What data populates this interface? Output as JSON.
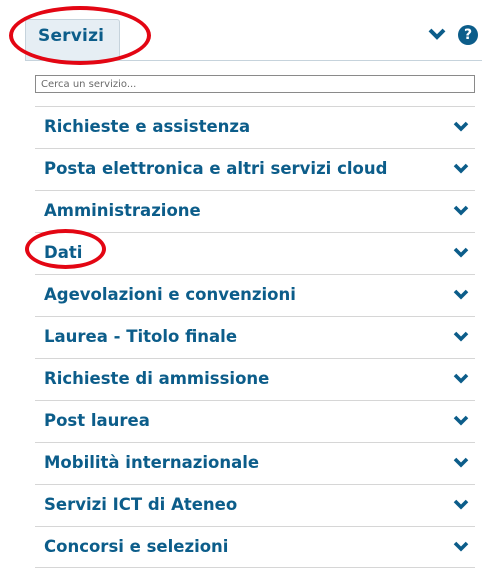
{
  "header": {
    "tab_label": "Servizi",
    "expand_icon": "chevron-down-icon",
    "help_icon": "help-icon",
    "help_glyph": "?"
  },
  "search": {
    "placeholder": "Cerca un servizio..."
  },
  "menu": {
    "items": [
      {
        "label": "Richieste e assistenza"
      },
      {
        "label": "Posta elettronica e altri servizi cloud"
      },
      {
        "label": "Amministrazione"
      },
      {
        "label": "Dati"
      },
      {
        "label": "Agevolazioni e convenzioni"
      },
      {
        "label": "Laurea - Titolo finale"
      },
      {
        "label": "Richieste di ammissione"
      },
      {
        "label": "Post laurea"
      },
      {
        "label": "Mobilità internazionale"
      },
      {
        "label": "Servizi ICT di Ateneo"
      },
      {
        "label": "Concorsi e selezioni"
      }
    ]
  },
  "colors": {
    "accent": "#0c5d8a",
    "highlight": "#e30613",
    "tab_bg": "#e6eef4"
  }
}
